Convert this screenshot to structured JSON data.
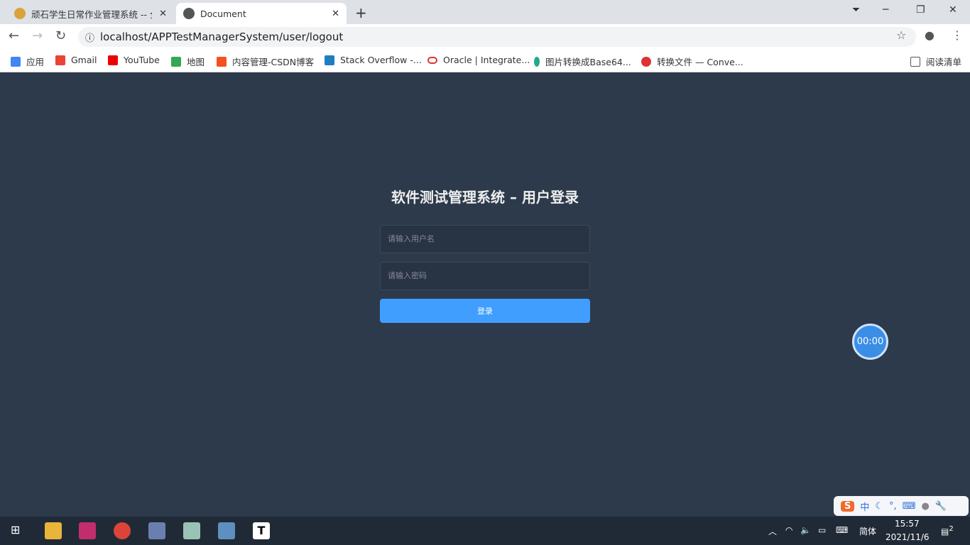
{
  "browser": {
    "tabs": [
      {
        "title": "顽石学生日常作业管理系统 -- 全",
        "active": false
      },
      {
        "title": "Document",
        "active": true
      }
    ],
    "url": "localhost/APPTestManagerSystem/user/logout",
    "bookmarks": [
      "应用",
      "Gmail",
      "YouTube",
      "地图",
      "内容管理-CSDN博客",
      "Stack Overflow -...",
      "Oracle | Integrate...",
      "图片转换成Base64...",
      "转换文件 — Conve..."
    ],
    "reading_list": "阅读清单"
  },
  "login": {
    "title": "软件测试管理系统 – 用户登录",
    "username_placeholder": "请输入用户名",
    "password_placeholder": "请输入密码",
    "submit": "登录"
  },
  "timer": "00:00",
  "ime": {
    "mode": "中"
  },
  "taskbar": {
    "lang": "简体",
    "time": "15:57",
    "date": "2021/11/6",
    "notifications": "2"
  },
  "colors": {
    "background": "#2d3a4b",
    "button": "#409eff"
  }
}
